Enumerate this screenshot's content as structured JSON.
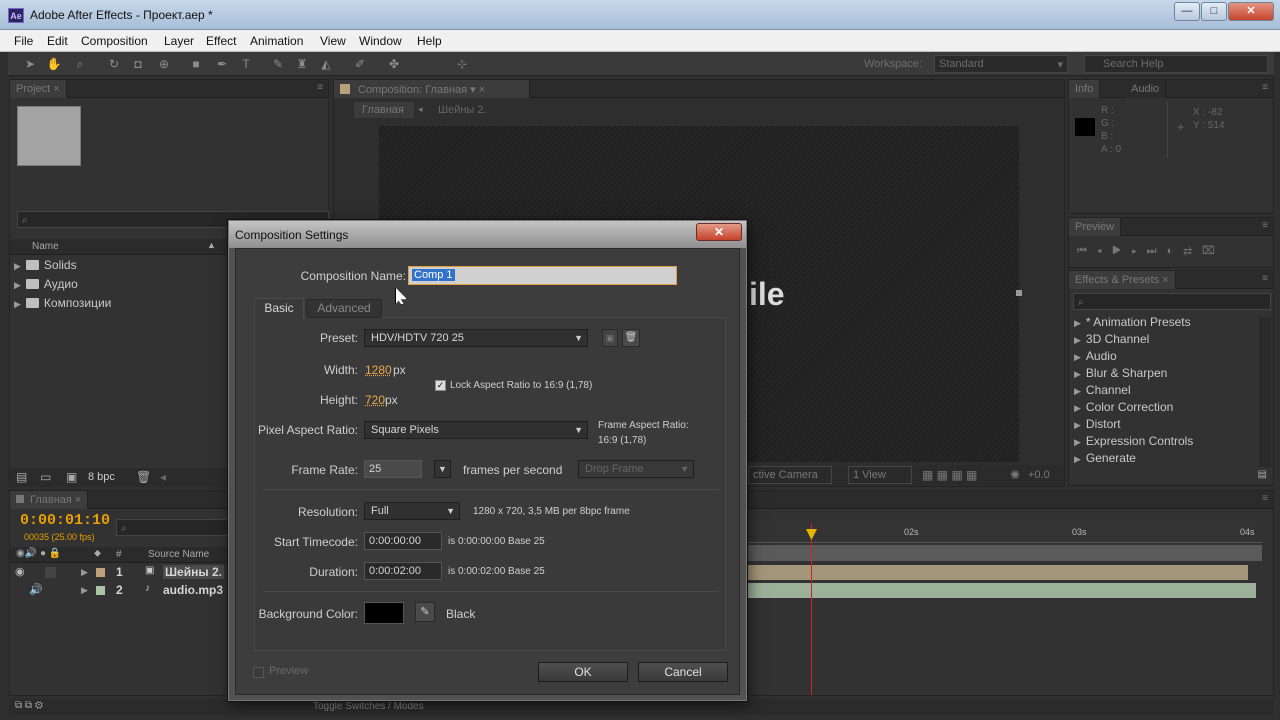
{
  "app": {
    "title": "Adobe After Effects - Проект.aep *",
    "logo": "Ae"
  },
  "window_controls": {
    "minimize": "—",
    "maximize": "□",
    "close": "✕"
  },
  "menubar": {
    "items": [
      "File",
      "Edit",
      "Composition",
      "Layer",
      "Effect",
      "Animation",
      "View",
      "Window",
      "Help"
    ]
  },
  "toolbar": {
    "workspace_label": "Workspace:",
    "workspace_value": "Standard",
    "search_placeholder": "Search Help"
  },
  "project_panel": {
    "tab": "Project",
    "column_name": "Name",
    "items": [
      "Solids",
      "Аудио",
      "Композиции"
    ],
    "bpc": "8 bpc"
  },
  "comp_panel": {
    "tab": "Composition: Главная",
    "breadcrumbs": [
      "Главная",
      "Шейны 2."
    ],
    "preview_text": "ile",
    "footer": {
      "camera": "ctive Camera",
      "view": "1 View",
      "exposure": "+0.0"
    }
  },
  "info_panel": {
    "tabs": [
      "Info",
      "Audio"
    ],
    "r": "R :",
    "g": "G :",
    "b": "B :",
    "a": "A : 0",
    "x": "X : -82",
    "y": "Y : 514"
  },
  "preview_panel": {
    "tab": "Preview"
  },
  "effects_panel": {
    "tab": "Effects & Presets",
    "items": [
      "* Animation Presets",
      "3D Channel",
      "Audio",
      "Blur & Sharpen",
      "Channel",
      "Color Correction",
      "Distort",
      "Expression Controls",
      "Generate"
    ]
  },
  "timeline": {
    "tab": "Главная",
    "timecode": "0:00:01:10",
    "frames": "00035 (25.00 fps)",
    "col_hash": "#",
    "col_source": "Source Name",
    "layers": [
      {
        "num": "1",
        "name": "Шейны 2."
      },
      {
        "num": "2",
        "name": "audio.mp3"
      }
    ],
    "ruler": [
      "02s",
      "03s",
      "04s"
    ],
    "toggle": "Toggle Switches / Modes"
  },
  "dialog": {
    "title": "Composition Settings",
    "close": "✕",
    "comp_name_label": "Composition Name:",
    "comp_name_value": "Comp 1",
    "tabs": [
      "Basic",
      "Advanced"
    ],
    "preset_label": "Preset:",
    "preset_value": "HDV/HDTV 720 25",
    "width_label": "Width:",
    "width_value": "1280",
    "height_label": "Height:",
    "height_value": "720",
    "unit_px": "px",
    "lock_aspect": "Lock Aspect Ratio to 16:9 (1,78)",
    "par_label": "Pixel Aspect Ratio:",
    "par_value": "Square Pixels",
    "frame_aspect_title": "Frame Aspect Ratio:",
    "frame_aspect_value": "16:9 (1,78)",
    "frame_rate_label": "Frame Rate:",
    "frame_rate_value": "25",
    "frames_per_second": "frames per second",
    "drop_frame": "Drop Frame",
    "resolution_label": "Resolution:",
    "resolution_value": "Full",
    "resolution_info": "1280 x 720, 3,5 MB per 8bpc frame",
    "start_tc_label": "Start Timecode:",
    "start_tc_value": "0:00:00:00",
    "start_tc_info": "is 0:00:00:00  Base 25",
    "duration_label": "Duration:",
    "duration_value": "0:00:02:00",
    "duration_info": "is 0:00:02:00  Base 25",
    "bg_label": "Background Color:",
    "bg_name": "Black",
    "bg_color": "#000000",
    "preview_label": "Preview",
    "ok": "OK",
    "cancel": "Cancel"
  },
  "colors": {
    "timecode": "#e8a000",
    "playhead": "#d32020",
    "accent_orange": "#e8a84e"
  }
}
